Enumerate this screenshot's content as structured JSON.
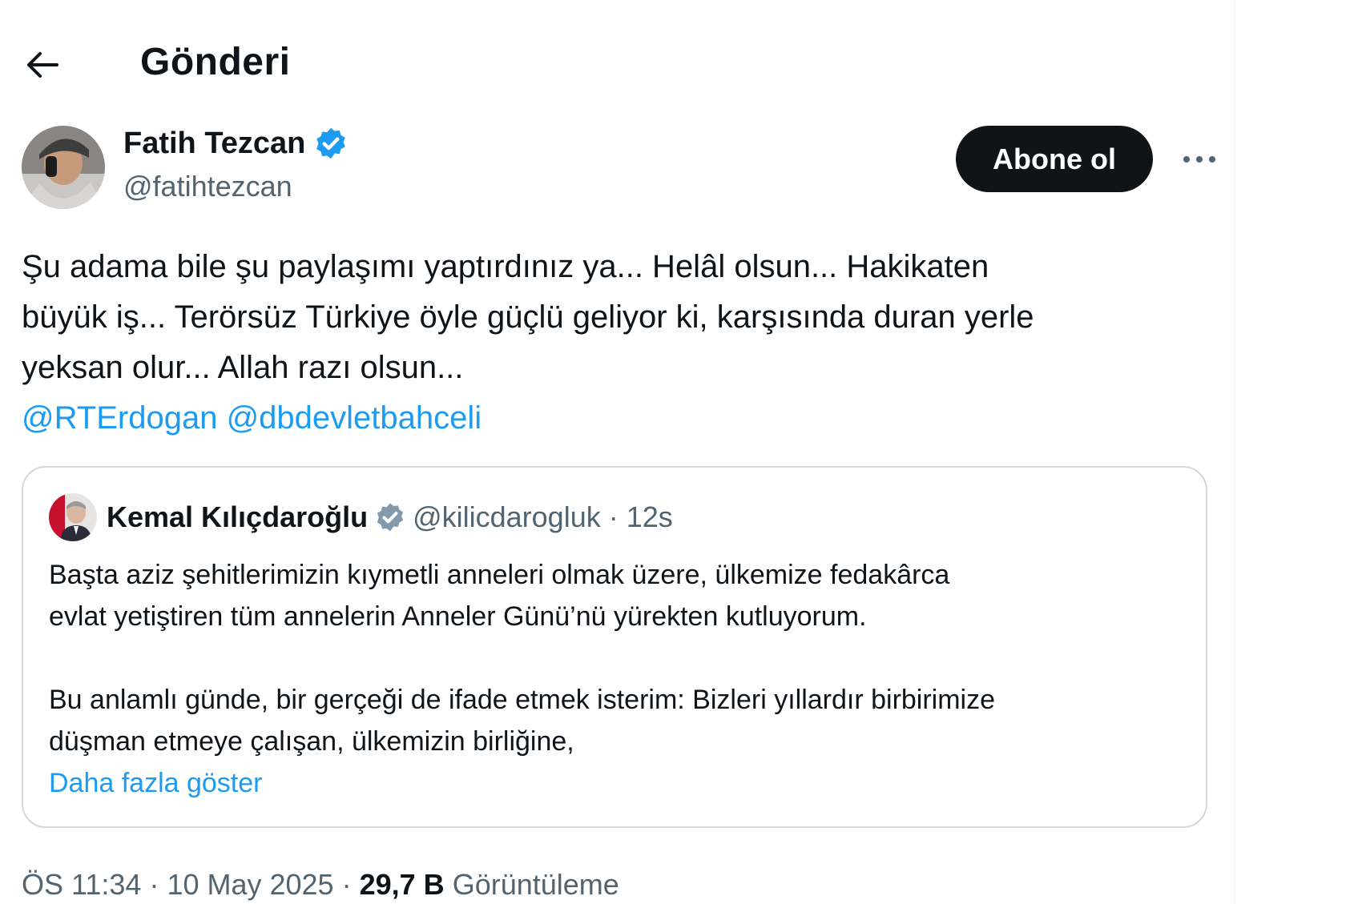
{
  "header": {
    "title": "Gönderi",
    "back_icon": "arrow-left-icon"
  },
  "post": {
    "author": {
      "name": "Fatih Tezcan",
      "handle": "@fatihtezcan",
      "verified": true,
      "verified_color": "#1d9bf0"
    },
    "follow_label": "Abone ol",
    "more_icon": "ellipsis-icon",
    "text_lines": [
      "Şu adama bile şu paylaşımı yaptırdınız ya... Helâl olsun... Hakikaten",
      "büyük iş... Terörsüz Türkiye öyle güçlü geliyor ki, karşısında duran yerle",
      "yeksan olur... Allah razı olsun..."
    ],
    "mentions": [
      "@RTErdogan",
      "@dbdevletbahceli"
    ],
    "quote": {
      "author_name": "Kemal Kılıçdaroğlu",
      "verified": true,
      "verified_color": "#829aab",
      "handle_time": "@kilicdarogluk · 12s",
      "paragraph1": [
        "Başta aziz şehitlerimizin kıymetli anneleri olmak üzere, ülkemize fedakârca",
        "evlat yetiştiren tüm annelerin Anneler Günü’nü yürekten kutluyorum."
      ],
      "paragraph2": [
        "Bu anlamlı günde, bir gerçeği de ifade etmek isterim: Bizleri yıllardır birbirimize",
        "düşman etmeye çalışan, ülkemizin birliğine,"
      ],
      "show_more": "Daha fazla göster"
    },
    "meta": {
      "time": "ÖS 11:34",
      "date": "10 May 2025",
      "separator": " · ",
      "views_count": "29,7 B",
      "views_label": "Görüntüleme"
    }
  },
  "colors": {
    "accent": "#1d9bf0",
    "text": "#0f1419",
    "secondary": "#536471",
    "border": "#cfd9de"
  }
}
